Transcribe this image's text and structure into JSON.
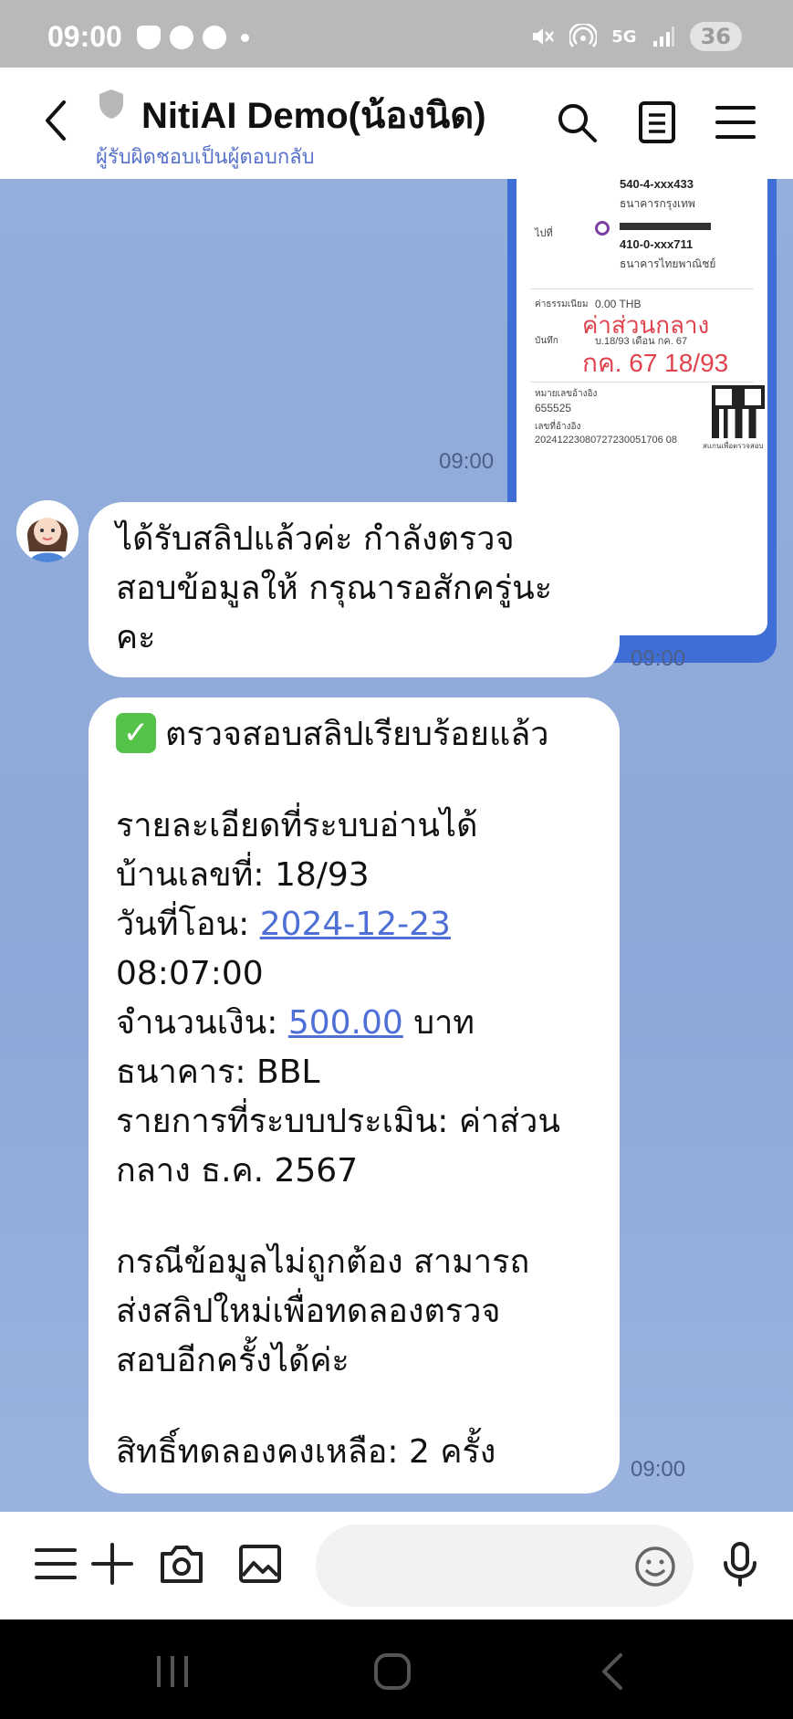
{
  "status_bar": {
    "time": "09:00",
    "network": "5G",
    "battery": "36"
  },
  "header": {
    "title": "NitiAI Demo(น้องนิด)",
    "subtitle": "ผู้รับผิดชอบเป็นผู้ตอบกลับ"
  },
  "slip": {
    "account1": "540-4-xxx433",
    "bank1": "ธนาคารกรุงเทพ",
    "to_label": "ไปที่",
    "account2": "410-0-xxx711",
    "bank2": "ธนาคารไทยพาณิชย์",
    "fee_label": "ค่าธรรมเนียม",
    "fee": "0.00 THB",
    "memo_label": "บันทึก",
    "memo": "บ.18/93 เดือน กค. 67",
    "handwritten1": "ค่าส่วนกลาง",
    "handwritten2": "กค. 67  18/93",
    "ref_label": "หมายเลขอ้างอิง",
    "ref": "655525",
    "ref2_label": "เลขที่อ้างอิง",
    "ref2": "20241223080727230051706 08",
    "qr_caption": "สแกนเพื่อตรวจสอบ"
  },
  "messages": {
    "slip_time": "09:00",
    "m1": {
      "lines": [
        "ได้รับสลิปแล้วค่ะ กำลังตรวจ",
        "สอบข้อมูลให้ กรุณารอสักครู่นะ",
        "คะ"
      ],
      "time": "09:00"
    },
    "m2": {
      "heading": "ตรวจสอบสลิปเรียบร้อยแล้ว",
      "details_title": "รายละเอียดที่ระบบอ่านได้",
      "house_label": "บ้านเลขที่: 18/93",
      "date_label": "วันที่โอน: ",
      "date_value": "2024-12-23",
      "time_value": "08:07:00",
      "amount_label": "จำนวนเงิน: ",
      "amount_value": "500.00",
      "amount_unit": " บาท",
      "bank": "ธนาคาร: BBL",
      "item_line1": "รายการที่ระบบประเมิน: ค่าส่วน",
      "item_line2": "กลาง ธ.ค. 2567",
      "note_line1": "กรณีข้อมูลไม่ถูกต้อง สามารถ",
      "note_line2": "ส่งสลิปใหม่เพื่อทดลองตรวจ",
      "note_line3": "สอบอีกครั้งได้ค่ะ",
      "remaining": "สิทธิ์ทดลองคงเหลือ: 2 ครั้ง",
      "time": "09:00"
    }
  },
  "input": {
    "placeholder": ""
  },
  "icons": {
    "accent": "#4e6fd6",
    "check_color": "#55c24a"
  }
}
